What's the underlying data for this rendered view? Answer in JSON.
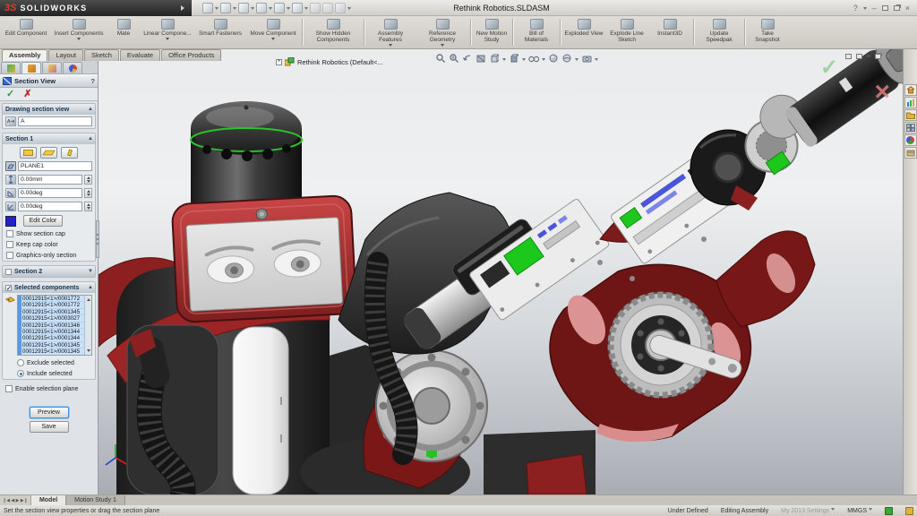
{
  "titlebar": {
    "brand_3ds": "3S",
    "brand": "SOLIDWORKS",
    "title": "Rethink Robotics.SLDASM",
    "help": "?"
  },
  "quick_toolbar": {
    "icons": [
      "new",
      "open",
      "save",
      "print",
      "undo",
      "select",
      "attach",
      "options",
      "display"
    ]
  },
  "command_manager": {
    "buttons": [
      {
        "label": "Edit Component"
      },
      {
        "label": "Insert Components",
        "dd": true
      },
      {
        "label": "Mate"
      },
      {
        "label": "Linear Compone...",
        "dd": true
      },
      {
        "label": "Smart Fasteners"
      },
      {
        "label": "Move Component",
        "dd": true
      },
      {
        "label": "Show Hidden Components",
        "dd": true
      },
      {
        "label": "Assembly Features",
        "dd": true
      },
      {
        "label": "Reference Geometry",
        "dd": true
      },
      {
        "label": "New Motion Study"
      },
      {
        "label": "Bill of Materials"
      },
      {
        "label": "Exploded View"
      },
      {
        "label": "Explode Line Sketch"
      },
      {
        "label": "Instant3D"
      },
      {
        "label": "Update Speedpak"
      },
      {
        "label": "Take Snapshot"
      }
    ]
  },
  "mode_tabs": {
    "items": [
      "Assembly",
      "Layout",
      "Sketch",
      "Evaluate",
      "Office Products"
    ],
    "active": "Assembly"
  },
  "feature_tree": {
    "root": "Rethink Robotics  (Default<..."
  },
  "property_manager": {
    "title": "Section View",
    "help": "?",
    "drawing_section_view": {
      "label": "Drawing section view",
      "name_value": "A"
    },
    "section1": {
      "label": "Section 1",
      "plane": "PLANE1",
      "offset": "0.00mm",
      "rot_x": "0.00deg",
      "rot_y": "0.00deg",
      "edit_color": "Edit Color",
      "show_section_cap": "Show section cap",
      "keep_cap_color": "Keep cap color",
      "graphics_only": "Graphics-only section"
    },
    "section2": {
      "label": "Section 2"
    },
    "selected_components": {
      "label": "Selected components",
      "items": [
        "00012915<1>/0001772",
        "00012915<1>/0001772",
        "00012915<1>/0001345",
        "00012915<1>/0003027",
        "00012915<1>/0001346",
        "00012915<1>/0001344",
        "00012915<1>/0001344",
        "00012915<1>/0001345",
        "00012915<1>/0001345"
      ],
      "exclude": "Exclude selected",
      "include": "Include selected",
      "enable_plane": "Enable selection plane"
    },
    "preview": "Preview",
    "save": "Save"
  },
  "viewport": {
    "confirm_ok": "✓",
    "confirm_cancel": "×"
  },
  "bottom_tabs": {
    "model": "Model",
    "motion": "Motion Study 1"
  },
  "status_bar": {
    "message": "Set the section view properties or drag the section plane",
    "define_state": "Under Defined",
    "mode": "Editing Assembly",
    "settings": "My 2013 Settings",
    "units": "MMGS"
  },
  "colors": {
    "selection_blue": "#5a9ae0",
    "robot_red": "#8a1f1f",
    "highlight_green": "#1dc81d",
    "plane_swatch_blue": "#2222cc"
  }
}
